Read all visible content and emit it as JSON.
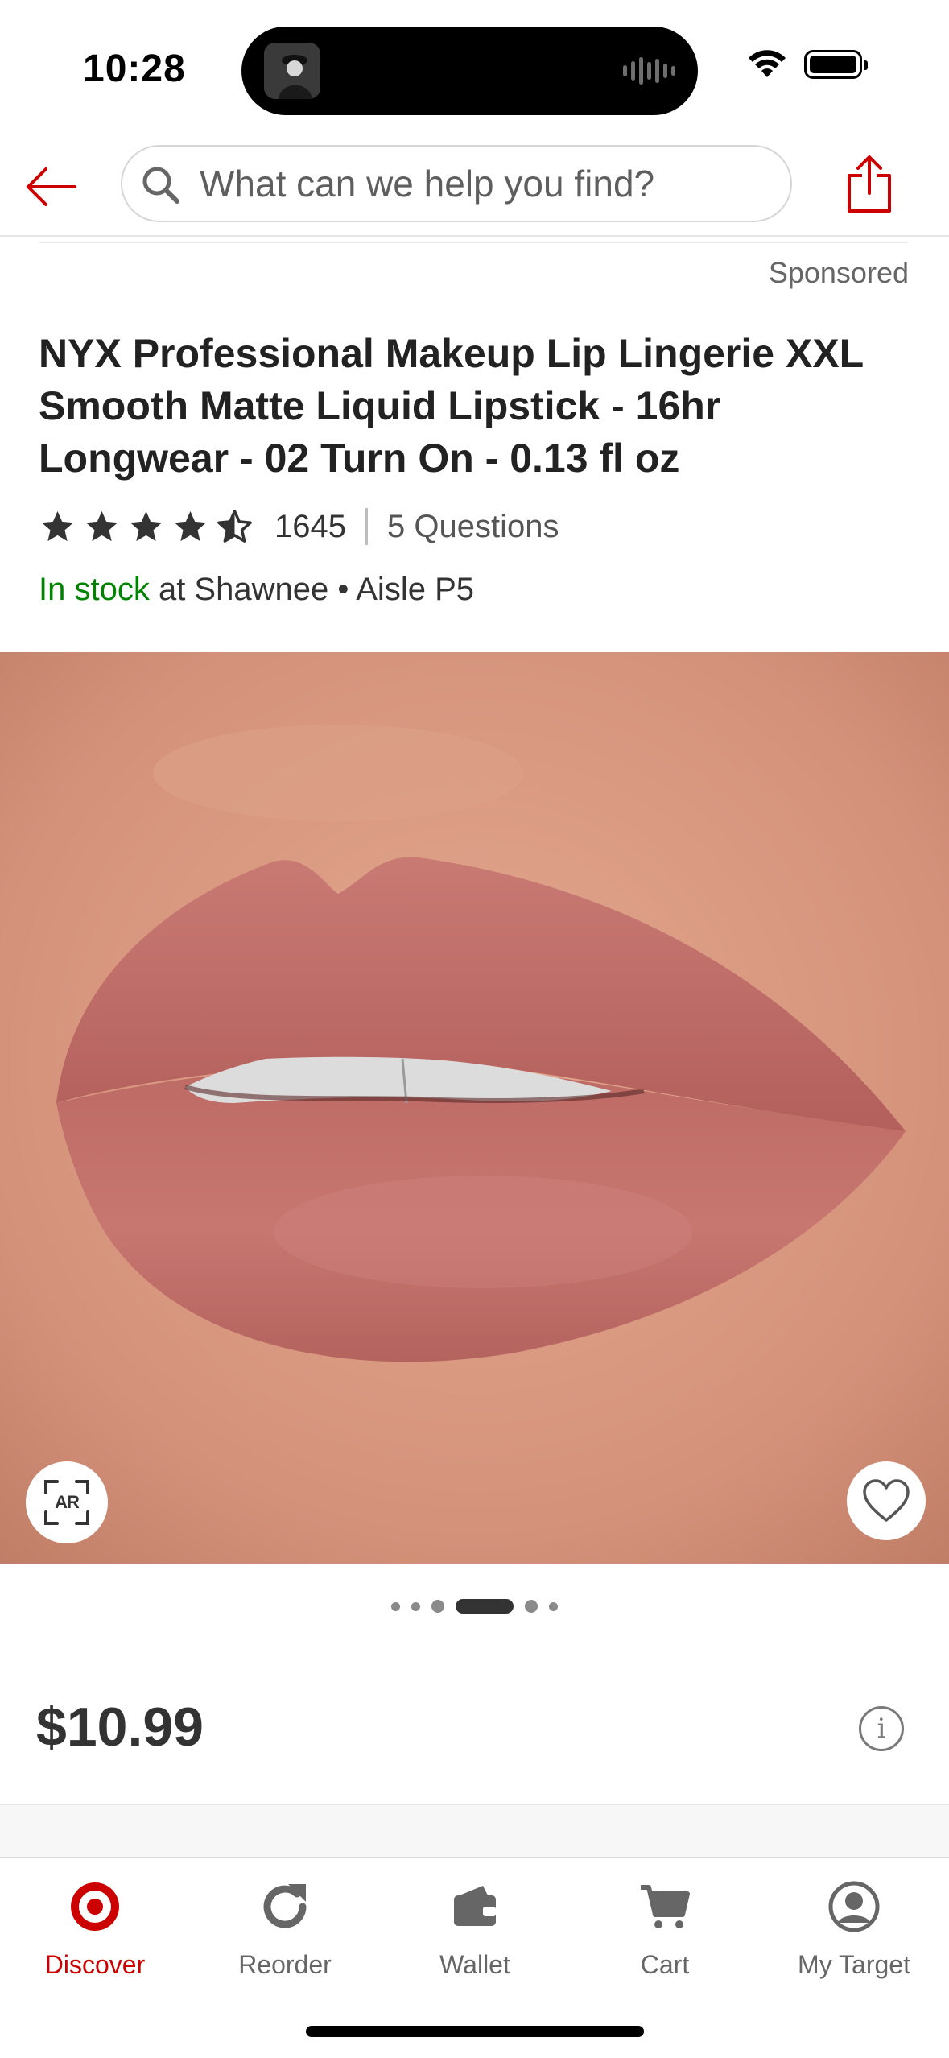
{
  "status_bar": {
    "time": "10:28"
  },
  "header": {
    "search_placeholder": "What can we help you find?"
  },
  "product": {
    "sponsored_label": "Sponsored",
    "title": "NYX Professional Makeup Lip Lingerie XXL Smooth Matte Liquid Lipstick - 16hr Longwear - 02 Turn On - 0.13 fl oz",
    "rating": 4.5,
    "rating_count": "1645",
    "questions_label": "5 Questions",
    "stock_status": "In stock",
    "stock_location": " at Shawnee • Aisle P5",
    "ar_label": "AR",
    "price": "$10.99",
    "info_symbol": "i"
  },
  "carousel": {
    "total": 6,
    "active_index": 3
  },
  "tabs": [
    {
      "label": "Discover",
      "icon": "target-bullseye-icon",
      "active": true
    },
    {
      "label": "Reorder",
      "icon": "reorder-refresh-icon",
      "active": false
    },
    {
      "label": "Wallet",
      "icon": "wallet-icon",
      "active": false
    },
    {
      "label": "Cart",
      "icon": "cart-icon",
      "active": false
    },
    {
      "label": "My Target",
      "icon": "account-icon",
      "active": false
    }
  ],
  "colors": {
    "brand_red": "#cc0000",
    "stock_green": "#008300",
    "text_dark": "#333333",
    "lip_color": "#c26863"
  }
}
